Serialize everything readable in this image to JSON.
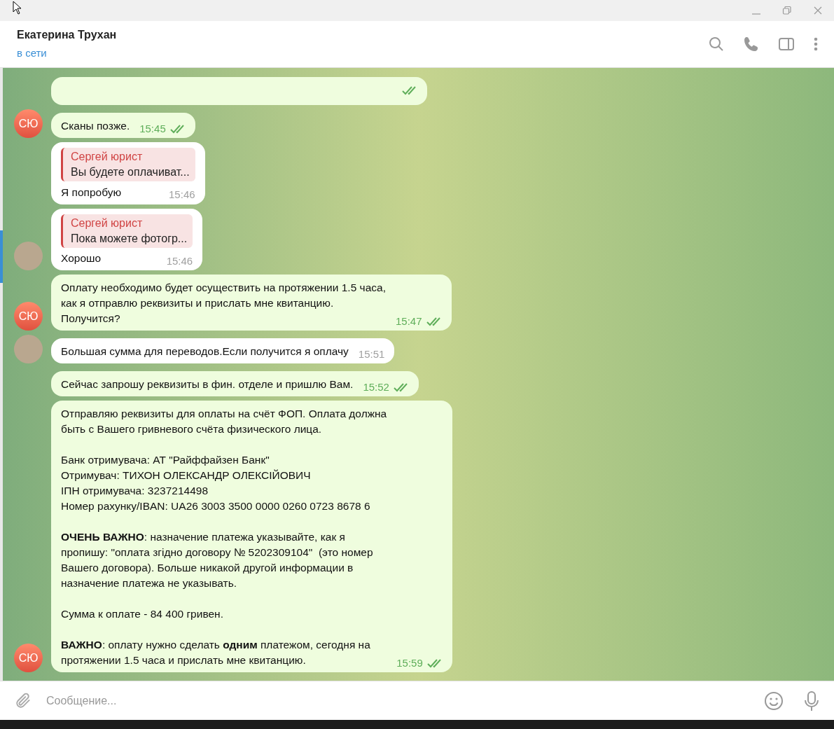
{
  "header": {
    "title": "Екатерина Трухан",
    "status": "в сети"
  },
  "messages": [
    {
      "kind": "outgoing",
      "read": true
    },
    {
      "kind": "outgoing",
      "text": "Сканы позже.",
      "time": "15:45",
      "read": true,
      "avatar": {
        "kind": "initials",
        "text": "СЮ"
      }
    },
    {
      "kind": "incoming",
      "reply": {
        "author": "Сергей юрист",
        "text": "Вы будете оплачиват..."
      },
      "text": "Я попробую",
      "time": "15:46"
    },
    {
      "kind": "incoming",
      "reply": {
        "author": "Сергей юрист",
        "text": "Пока можете фотогр..."
      },
      "text": "Хорошо",
      "time": "15:46",
      "avatar": {
        "kind": "photo"
      }
    },
    {
      "kind": "outgoing",
      "text": "Оплату необходимо будет осуществить на протяжении 1.5 часа,\nкак я отправлю реквизиты и прислать мне квитанцию.\nПолучится?",
      "time": "15:47",
      "read": true,
      "avatar": {
        "kind": "initials",
        "text": "СЮ"
      }
    },
    {
      "kind": "incoming",
      "text": "Большая сумма для переводов.Если получится я оплачу",
      "time": "15:51",
      "avatar": {
        "kind": "photo"
      }
    },
    {
      "kind": "outgoing",
      "text": "Сейчас запрошу реквизиты в фин. отделе и пришлю Вам.",
      "time": "15:52",
      "read": true
    },
    {
      "kind": "outgoing",
      "text": "Отправляю реквизиты для оплаты на счёт ФОП. Оплата должна\nбыть с Вашего гривневого счёта физического лица.\n\nБанк отримувача: АТ \"Райффайзен Банк\"\nОтримувач: ТИХОН ОЛЕКСАНДР ОЛЕКСІЙОВИЧ\nІПН отримувача: 3237214498\nНомер рахунку/IBAN: UA26 3003 3500 0000 0260 0723 8678 6\n\n**ОЧЕНЬ ВАЖНО**: назначение платежа указывайте, как я\nпропишу: \"оплата згідно договору № 5202309104\"  (это номер\nВашего договора). Больше никакой другой информации в\nназначение платежа не указывать.\n\nСумма к оплате - 84 400 гривен.\n\n**ВАЖНО**: оплату нужно сделать **одним** платежом, сегодня на\nпротяжении 1.5 часа и прислать мне квитанцию.",
      "time": "15:59",
      "read": true,
      "avatar": {
        "kind": "initials",
        "text": "СЮ"
      }
    }
  ],
  "composer": {
    "placeholder": "Сообщение..."
  }
}
